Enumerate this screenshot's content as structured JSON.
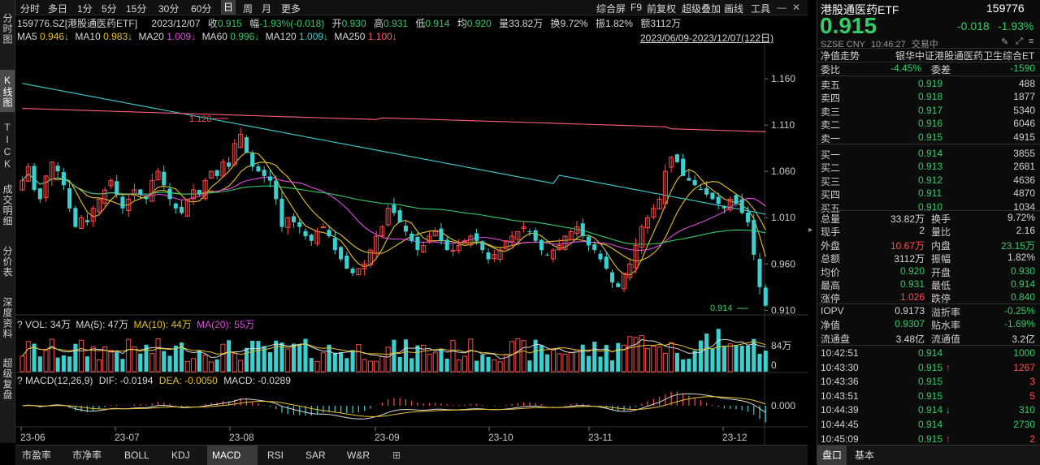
{
  "left_tabs": [
    "分时图",
    "K线图",
    "TICK",
    "成交明细",
    "分价表",
    "深度资料",
    "超级复盘"
  ],
  "toolbar": {
    "periods": [
      "分时",
      "多日",
      "1分",
      "5分",
      "15分",
      "30分",
      "60分",
      "日",
      "周",
      "月",
      "更多"
    ],
    "active_period": "日",
    "right_items": [
      "综合屏",
      "F9",
      "前复权",
      "超级叠加",
      "画线",
      "工具"
    ]
  },
  "quote_line": {
    "code": "159776.SZ[港股通医药ETF]",
    "date": "2023/12/07",
    "close_label": "收",
    "close": "0.915",
    "change_label": "幅",
    "change": "-1.93%(-0.018)",
    "open_label": "开",
    "open": "0.930",
    "high_label": "高",
    "high": "0.931",
    "low_label": "低",
    "low": "0.914",
    "avg_label": "均",
    "avg": "0.920",
    "vol_label": "量",
    "vol": "33.82万",
    "turnover_label": "换",
    "turnover": "9.72%",
    "amp_label": "振",
    "amp": "1.82%",
    "amount_label": "额",
    "amount": "3112万"
  },
  "ma_line": [
    {
      "label": "MA5",
      "value": "0.946↓",
      "color": "#e6c229"
    },
    {
      "label": "MA10",
      "value": "0.983↓",
      "color": "#e6c229"
    },
    {
      "label": "MA20",
      "value": "1.009↓",
      "color": "#e04be0"
    },
    {
      "label": "MA60",
      "value": "0.996↓",
      "color": "#33cc66"
    },
    {
      "label": "MA120",
      "value": "1.009↓",
      "color": "#3ad0d0"
    },
    {
      "label": "MA250",
      "value": "1.100↓",
      "color": "#ff5f7a"
    }
  ],
  "date_range": "2023/06/09-2023/12/07(122日)",
  "price_axis": [
    "1.160",
    "1.110",
    "1.060",
    "1.010",
    "0.960",
    "0.910"
  ],
  "high_marker": "1.120",
  "low_marker": "0.914",
  "vol_line": {
    "prefix": "VOL: 34万",
    "ma5": "MA(5): 47万",
    "ma10": "MA(10): 44万",
    "ma20": "MA(20): 55万"
  },
  "vol_axis": [
    "84万",
    "0"
  ],
  "macd_line": {
    "prefix": "MACD(12,26,9)",
    "dif": "DIF: -0.0194",
    "dea": "DEA: -0.0050",
    "macd": "MACD: -0.0289"
  },
  "macd_axis": [
    "0.000"
  ],
  "x_axis": [
    "23-06",
    "23-07",
    "23-08",
    "23-09",
    "23-10",
    "23-11",
    "23-12"
  ],
  "bottom_tabs": [
    "市盈率",
    "市净率",
    "BOLL",
    "KDJ",
    "MACD",
    "RSI",
    "SAR",
    "W&R"
  ],
  "active_bottom_tab": "MACD",
  "right": {
    "name": "港股通医药ETF",
    "code": "159776",
    "price": "0.915",
    "change": "-0.018",
    "change_pct": "-1.93%",
    "exchange": "SZSE CNY",
    "time": "10:46:27",
    "status": "交易中",
    "nav_trend_label": "净值走势",
    "index_name": "银华中证港股通医药卫生综合ET",
    "weibi_label": "委比",
    "weibi": "-4.45%",
    "weicha_label": "委差",
    "weicha": "-1590",
    "asks": [
      {
        "label": "卖五",
        "price": "0.919",
        "vol": "488"
      },
      {
        "label": "卖四",
        "price": "0.918",
        "vol": "1877"
      },
      {
        "label": "卖三",
        "price": "0.917",
        "vol": "5340"
      },
      {
        "label": "卖二",
        "price": "0.916",
        "vol": "6046"
      },
      {
        "label": "卖一",
        "price": "0.915",
        "vol": "4915"
      }
    ],
    "bids": [
      {
        "label": "买一",
        "price": "0.914",
        "vol": "3855"
      },
      {
        "label": "买二",
        "price": "0.913",
        "vol": "2681"
      },
      {
        "label": "买三",
        "price": "0.912",
        "vol": "4636"
      },
      {
        "label": "买四",
        "price": "0.911",
        "vol": "4870"
      },
      {
        "label": "买五",
        "price": "0.910",
        "vol": "1034"
      }
    ],
    "stats": [
      {
        "l1": "总量",
        "v1": "33.82万",
        "c1": "#d8d8d8",
        "l2": "换手",
        "v2": "9.72%",
        "c2": "#d8d8d8"
      },
      {
        "l1": "现手",
        "v1": "2",
        "c1": "#d8d8d8",
        "l2": "量比",
        "v2": "2.16",
        "c2": "#d8d8d8"
      },
      {
        "l1": "外盘",
        "v1": "10.67万",
        "c1": "#ff4b4b",
        "l2": "内盘",
        "v2": "23.15万",
        "c2": "#33cc66"
      },
      {
        "l1": "总额",
        "v1": "3112万",
        "c1": "#d8d8d8",
        "l2": "振幅",
        "v2": "1.82%",
        "c2": "#d8d8d8"
      },
      {
        "l1": "均价",
        "v1": "0.920",
        "c1": "#33cc66",
        "l2": "开盘",
        "v2": "0.930",
        "c2": "#33cc66"
      },
      {
        "l1": "最高",
        "v1": "0.931",
        "c1": "#33cc66",
        "l2": "最低",
        "v2": "0.914",
        "c2": "#33cc66"
      },
      {
        "l1": "涨停",
        "v1": "1.026",
        "c1": "#ff4b4b",
        "l2": "跌停",
        "v2": "0.840",
        "c2": "#33cc66"
      }
    ],
    "stats2": [
      {
        "l1": "IOPV",
        "v1": "0.9173",
        "c1": "#d8d8d8",
        "l2": "溢折率",
        "v2": "-0.25%",
        "c2": "#33cc66"
      },
      {
        "l1": "净值",
        "v1": "0.9307",
        "c1": "#33cc66",
        "l2": "贴水率",
        "v2": "-1.69%",
        "c2": "#33cc66"
      },
      {
        "l1": "流通盘",
        "v1": "3.48亿",
        "c1": "#d8d8d8",
        "l2": "流通值",
        "v2": "3.2亿",
        "c2": "#d8d8d8"
      }
    ],
    "ticks": [
      {
        "time": "10:42:51",
        "price": "0.914",
        "arrow": "",
        "vol": "1000",
        "pc": "#33cc66",
        "vc": "#33cc66"
      },
      {
        "time": "10:43:30",
        "price": "0.915",
        "arrow": "↑",
        "vol": "1267",
        "pc": "#33cc66",
        "vc": "#ff4b4b"
      },
      {
        "time": "10:43:36",
        "price": "0.915",
        "arrow": "",
        "vol": "3",
        "pc": "#33cc66",
        "vc": "#ff4b4b"
      },
      {
        "time": "10:43:51",
        "price": "0.915",
        "arrow": "",
        "vol": "5",
        "pc": "#33cc66",
        "vc": "#ff4b4b"
      },
      {
        "time": "10:44:39",
        "price": "0.914",
        "arrow": "↓",
        "vol": "310",
        "pc": "#33cc66",
        "vc": "#33cc66"
      },
      {
        "time": "10:44:45",
        "price": "0.914",
        "arrow": "",
        "vol": "2730",
        "pc": "#33cc66",
        "vc": "#33cc66"
      },
      {
        "time": "10:45:09",
        "price": "0.915",
        "arrow": "↑",
        "vol": "2",
        "pc": "#33cc66",
        "vc": "#ff4b4b"
      }
    ],
    "bottom_tabs": [
      "盘口",
      "基本"
    ]
  },
  "chart_data": {
    "type": "candlestick",
    "ylim": [
      0.905,
      1.175
    ],
    "closes": [
      1.05,
      1.065,
      1.04,
      1.03,
      1.055,
      1.07,
      1.06,
      1.045,
      1.02,
      1.0,
      1.01,
      1.005,
      1.02,
      1.03,
      1.04,
      1.05,
      1.035,
      1.02,
      1.03,
      1.04,
      1.035,
      1.03,
      1.05,
      1.06,
      1.045,
      1.03,
      1.02,
      1.015,
      1.03,
      1.04,
      1.035,
      1.05,
      1.06,
      1.055,
      1.07,
      1.065,
      1.09,
      1.1,
      1.08,
      1.065,
      1.06,
      1.055,
      1.05,
      1.03,
      1.0,
      1.01,
      1.005,
      1.0,
      0.99,
      0.985,
      0.995,
      1.0,
      0.99,
      0.975,
      0.965,
      0.955,
      0.95,
      0.955,
      0.96,
      0.975,
      0.99,
      1.0,
      1.02,
      1.015,
      1.005,
      0.995,
      0.985,
      0.975,
      0.98,
      0.99,
      0.995,
      0.985,
      0.975,
      0.975,
      0.98,
      0.985,
      0.99,
      0.985,
      0.975,
      0.965,
      0.97,
      0.975,
      0.985,
      0.99,
      0.995,
      1.0,
      0.995,
      0.985,
      0.975,
      0.97,
      0.975,
      0.98,
      0.99,
      0.995,
      1.0,
      0.99,
      0.98,
      0.975,
      0.965,
      0.955,
      0.94,
      0.935,
      0.95,
      0.96,
      0.98,
      1.0,
      1.01,
      1.02,
      1.03,
      1.06,
      1.075,
      1.07,
      1.055,
      1.05,
      1.045,
      1.04,
      1.035,
      1.03,
      1.025,
      1.02,
      1.03,
      1.025,
      1.015,
      1.005,
      0.97,
      0.935,
      0.915
    ]
  }
}
